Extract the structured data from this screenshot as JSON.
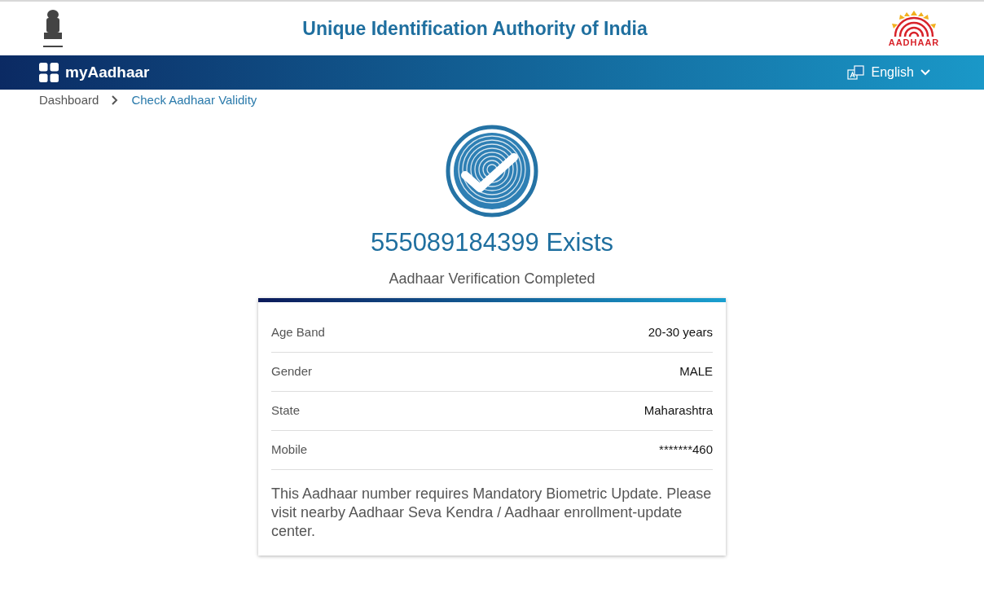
{
  "header": {
    "title": "Unique Identification Authority of India",
    "logo_text": "AADHAAR"
  },
  "navbar": {
    "brand": "myAadhaar",
    "language": "English"
  },
  "breadcrumb": [
    {
      "label": "Dashboard",
      "current": false
    },
    {
      "label": "Check Aadhaar Validity",
      "current": true
    }
  ],
  "result": {
    "heading": "555089184399 Exists",
    "subheading": "Aadhaar Verification Completed"
  },
  "details": [
    {
      "label": "Age Band",
      "value": "20-30 years"
    },
    {
      "label": "Gender",
      "value": "MALE"
    },
    {
      "label": "State",
      "value": "Maharashtra"
    },
    {
      "label": "Mobile",
      "value": "*******460"
    }
  ],
  "notice": "This Aadhaar number requires Mandatory Biometric Update. Please visit nearby Aadhaar Seva Kendra / Aadhaar enrollment-update center."
}
